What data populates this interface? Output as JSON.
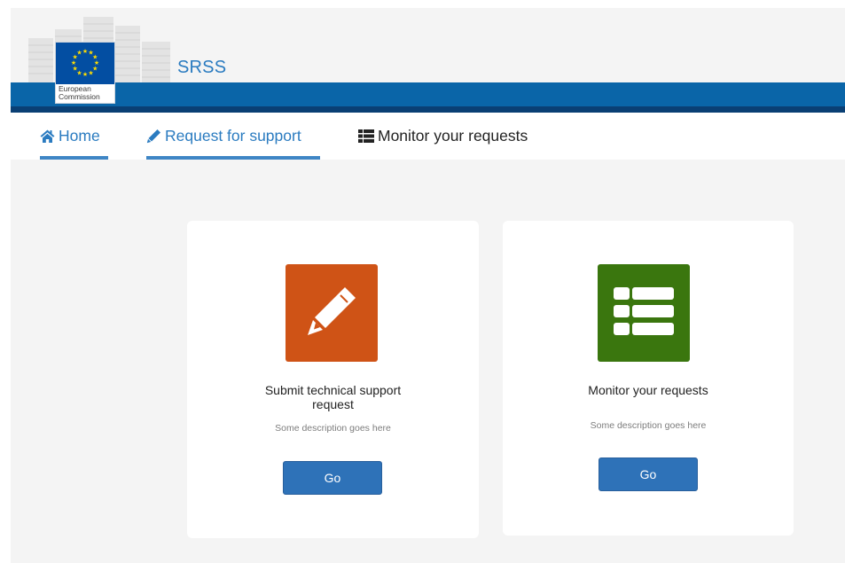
{
  "header": {
    "logo_text_line1": "European",
    "logo_text_line2": "Commission",
    "site_title": "SRSS"
  },
  "nav": {
    "items": [
      {
        "label": "Home",
        "icon": "home-icon",
        "active": true
      },
      {
        "label": "Request for support",
        "icon": "pencil-icon",
        "active": true
      },
      {
        "label": "Monitor your requests",
        "icon": "list-icon",
        "active": false
      }
    ]
  },
  "cards": [
    {
      "title": "Submit technical support request",
      "description": "Some description goes here",
      "button_label": "Go",
      "icon": "pencil-icon",
      "tile_color": "#cf5316"
    },
    {
      "title": "Monitor your requests",
      "description": "Some description goes here",
      "button_label": "Go",
      "icon": "list-icon",
      "tile_color": "#3a760e"
    }
  ],
  "colors": {
    "accent": "#2a7bc0",
    "header_band": "#0a65a8",
    "header_band_dark": "#0a3f74",
    "button": "#2e72b8",
    "page_background": "#f4f4f4"
  }
}
